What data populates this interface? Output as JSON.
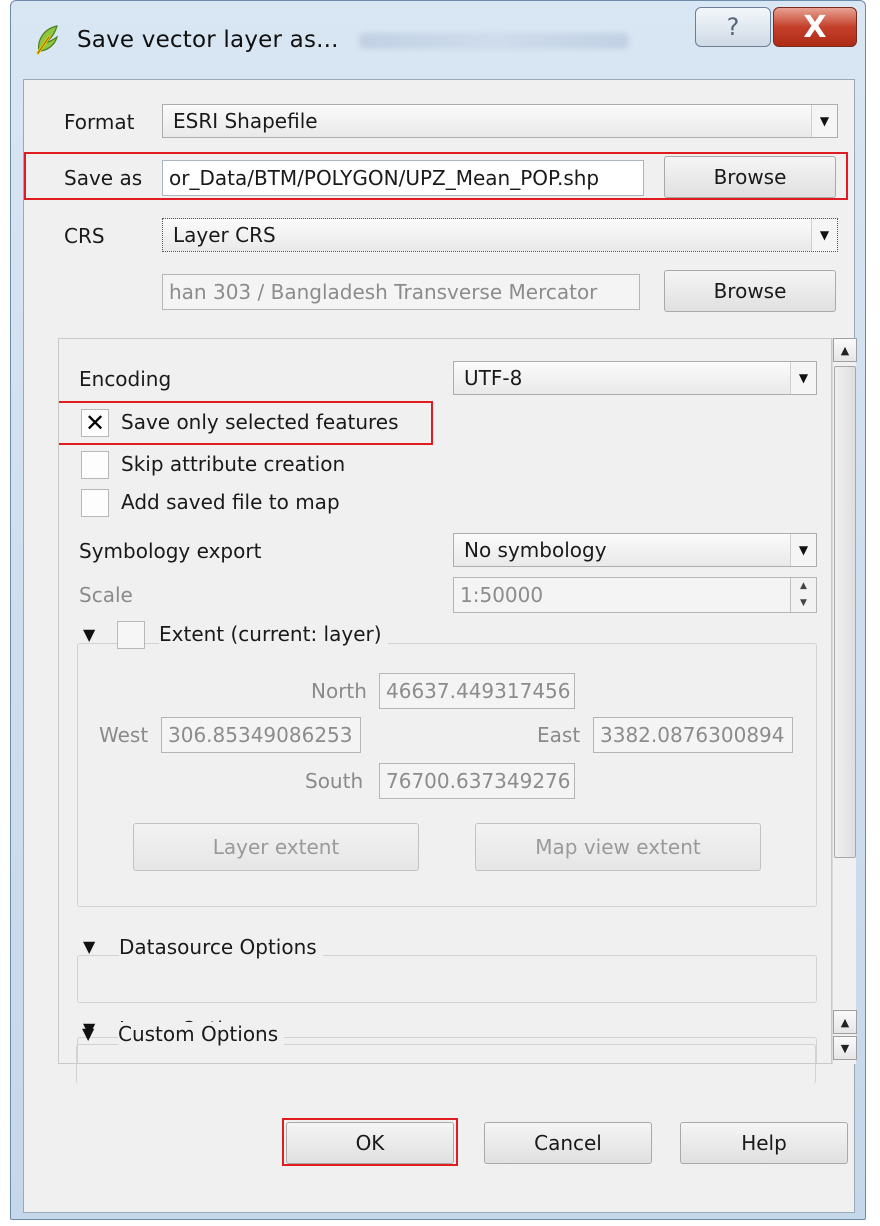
{
  "window": {
    "title": "Save vector layer as...",
    "help_glyph": "?",
    "close_glyph": "X"
  },
  "form": {
    "format_label": "Format",
    "format_value": "ESRI Shapefile",
    "save_as_label": "Save as",
    "save_as_value": "or_Data/BTM/POLYGON/UPZ_Mean_POP.shp",
    "browse_label": "Browse",
    "crs_label": "CRS",
    "crs_value": "Layer CRS",
    "crs_description": "han 303 / Bangladesh Transverse Mercator",
    "crs_browse_label": "Browse"
  },
  "options": {
    "encoding_label": "Encoding",
    "encoding_value": "UTF-8",
    "save_selected_label": "Save only selected features",
    "save_selected_checked": true,
    "skip_attr_label": "Skip attribute creation",
    "add_to_map_label": "Add saved file to map",
    "symbology_label": "Symbology export",
    "symbology_value": "No symbology",
    "scale_label": "Scale",
    "scale_value": "1:50000"
  },
  "extent": {
    "title": "Extent (current: layer)",
    "north_label": "North",
    "north_value": "46637.449317456",
    "west_label": "West",
    "west_value": "306.85349086253",
    "east_label": "East",
    "east_value": "3382.0876300894",
    "south_label": "South",
    "south_value": "76700.637349276",
    "layer_extent_label": "Layer extent",
    "map_view_extent_label": "Map view extent"
  },
  "sections": {
    "datasource": "Datasource Options",
    "layer": "Layer Options",
    "custom": "Custom Options"
  },
  "footer": {
    "ok": "OK",
    "cancel": "Cancel",
    "help": "Help"
  },
  "colors": {
    "highlight": "#e11b22",
    "titlebar": "#c5d7ea",
    "close_button": "#c4402a"
  },
  "icons": {
    "app": "qgis-icon",
    "dropdown": "chevron-down-icon",
    "checkbox_checked": "x-mark-icon",
    "collapse": "triangle-down-icon"
  }
}
